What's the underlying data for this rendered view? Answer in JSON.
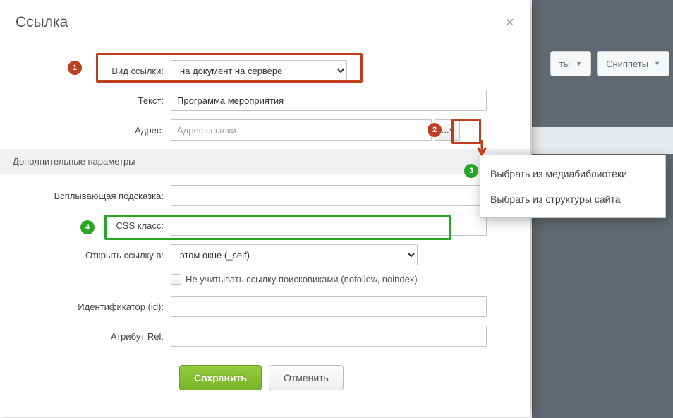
{
  "dialog": {
    "title": "Ссылка",
    "close": "×"
  },
  "rows": {
    "linktype_label": "Вид ссылки:",
    "linktype_value": "на документ на сервере",
    "text_label": "Текст:",
    "text_value": "Программа мероприятия",
    "address_label": "Адрес:",
    "address_placeholder": "Адрес ссылки",
    "browse_label": "…▾"
  },
  "section": {
    "extra": "Дополнительные параметры"
  },
  "extra": {
    "tooltip_label": "Всплывающая подсказка:",
    "cssclass_label": "CSS класс:",
    "target_label": "Открыть ссылку в:",
    "target_value": "этом окне (_self)",
    "nofollow_label": "Не учитывать ссылку поисковиками (nofollow, noindex)",
    "id_label": "Идентификатор (id):",
    "rel_label": "Атрибут Rel:"
  },
  "footer": {
    "save": "Сохранить",
    "cancel": "Отменить"
  },
  "dropdown": {
    "item1": "Выбрать из медиабиблиотеки",
    "item2": "Выбрать из структуры сайта"
  },
  "bg": {
    "btn1": "ты",
    "btn2": "Сниппеты"
  },
  "markers": {
    "m1": "1",
    "m2": "2",
    "m3": "3",
    "m4": "4"
  }
}
